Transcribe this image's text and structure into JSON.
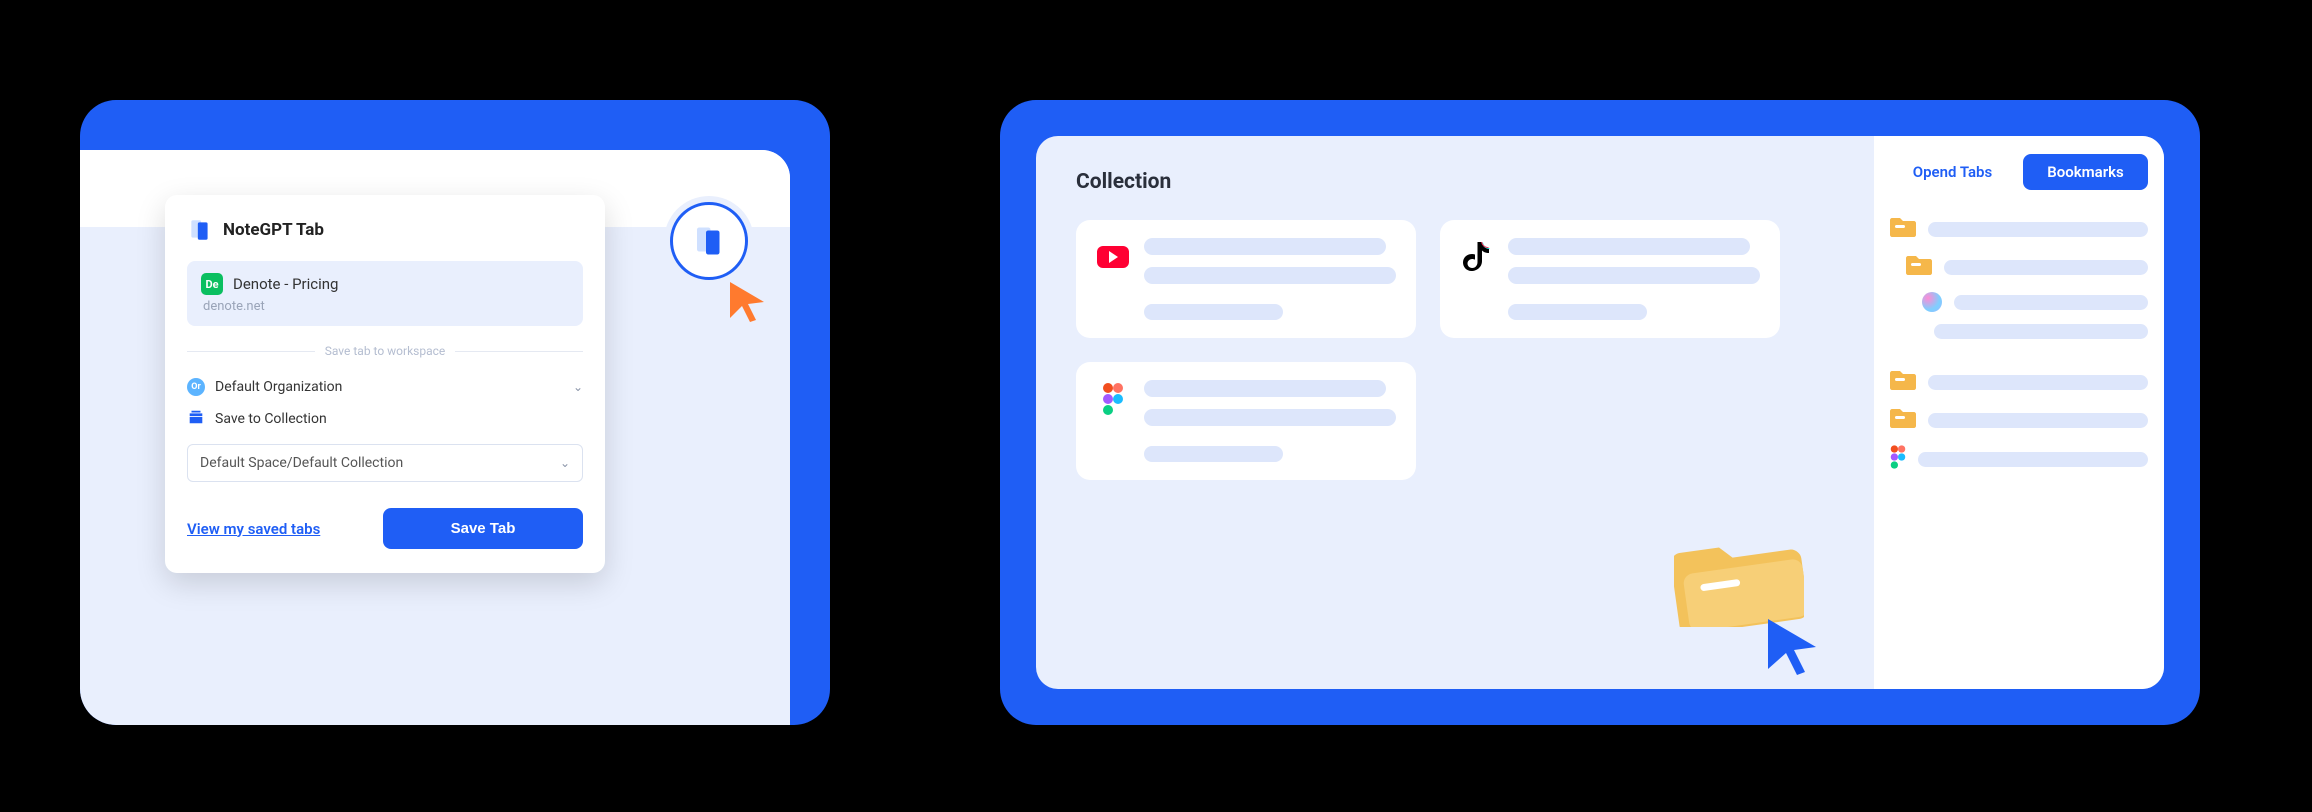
{
  "popup": {
    "title": "NoteGPT Tab",
    "site_name": "Denote - Pricing",
    "site_url": "denote.net",
    "site_abbr": "De",
    "divider_text": "Save tab to workspace",
    "org_label": "Default Organization",
    "org_abbr": "Or",
    "collection_label": "Save to Collection",
    "select_value": "Default Space/Default Collection",
    "view_link": "View my saved tabs",
    "save_button": "Save Tab"
  },
  "right": {
    "collection_title": "Collection",
    "tab_open": "Opend Tabs",
    "tab_bookmarks": "Bookmarks",
    "cards": [
      {
        "icon": "youtube"
      },
      {
        "icon": "tiktok"
      },
      {
        "icon": "figma"
      }
    ],
    "tree": [
      {
        "icon": "folder",
        "indent": 0
      },
      {
        "icon": "folder",
        "indent": 1
      },
      {
        "icon": "gradient",
        "indent": 2
      },
      {
        "icon": "youtube",
        "indent": 2
      },
      {
        "icon": "spacer"
      },
      {
        "icon": "folder",
        "indent": 0
      },
      {
        "icon": "folder",
        "indent": 0
      },
      {
        "icon": "figma",
        "indent": 0
      }
    ]
  }
}
